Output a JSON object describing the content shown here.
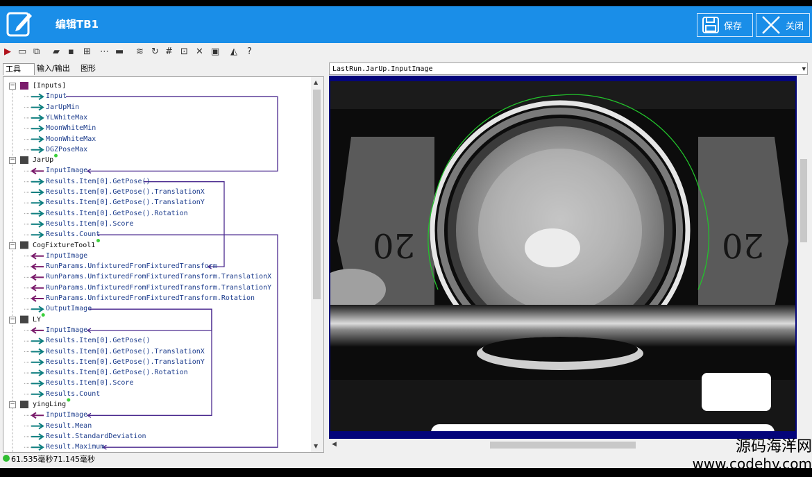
{
  "window": {
    "title": "编辑TB1",
    "save_label": "保存",
    "close_label": "关闭"
  },
  "tabs": [
    {
      "label": "工具",
      "active": true
    },
    {
      "label": "输入/输出",
      "active": false
    },
    {
      "label": "图形",
      "active": false
    }
  ],
  "toolbar_icons": [
    "run-icon",
    "image-icon",
    "link-icon",
    "open-folder-icon",
    "save-disk-icon",
    "network-icon",
    "dashes-icon",
    "tag-icon",
    "database-icon",
    "refresh-icon",
    "numeric-icon",
    "zoom-icon",
    "wrench-icon",
    "code-icon",
    "chart-icon",
    "help-icon"
  ],
  "tree": [
    {
      "kind": "group",
      "label": "[Inputs]",
      "icon": "input-arrow-icon"
    },
    {
      "kind": "out",
      "label": "Input"
    },
    {
      "kind": "out",
      "label": "JarUpMin"
    },
    {
      "kind": "out",
      "label": "YLWhiteMax"
    },
    {
      "kind": "out",
      "label": "MoonWhiteMin"
    },
    {
      "kind": "out",
      "label": "MoonWhiteMax"
    },
    {
      "kind": "out",
      "label": "DGZPoseMax"
    },
    {
      "kind": "tool",
      "label": "JarUp",
      "icon": "pattern-tool-icon"
    },
    {
      "kind": "in",
      "label": "InputImage"
    },
    {
      "kind": "out",
      "label": "Results.Item[0].GetPose()"
    },
    {
      "kind": "out",
      "label": "Results.Item[0].GetPose().TranslationX"
    },
    {
      "kind": "out",
      "label": "Results.Item[0].GetPose().TranslationY"
    },
    {
      "kind": "out",
      "label": "Results.Item[0].GetPose().Rotation"
    },
    {
      "kind": "out",
      "label": "Results.Item[0].Score"
    },
    {
      "kind": "out",
      "label": "Results.Count"
    },
    {
      "kind": "tool",
      "label": "CogFixtureTool1",
      "icon": "fixture-tool-icon"
    },
    {
      "kind": "in",
      "label": "InputImage"
    },
    {
      "kind": "in",
      "label": "RunParams.UnfixturedFromFixturedTransform"
    },
    {
      "kind": "in",
      "label": "RunParams.UnfixturedFromFixturedTransform.TranslationX"
    },
    {
      "kind": "in",
      "label": "RunParams.UnfixturedFromFixturedTransform.TranslationY"
    },
    {
      "kind": "in",
      "label": "RunParams.UnfixturedFromFixturedTransform.Rotation"
    },
    {
      "kind": "out",
      "label": "OutputImage"
    },
    {
      "kind": "tool",
      "label": "LY",
      "icon": "pattern-tool-icon"
    },
    {
      "kind": "in",
      "label": "InputImage"
    },
    {
      "kind": "out",
      "label": "Results.Item[0].GetPose()"
    },
    {
      "kind": "out",
      "label": "Results.Item[0].GetPose().TranslationX"
    },
    {
      "kind": "out",
      "label": "Results.Item[0].GetPose().TranslationY"
    },
    {
      "kind": "out",
      "label": "Results.Item[0].GetPose().Rotation"
    },
    {
      "kind": "out",
      "label": "Results.Item[0].Score"
    },
    {
      "kind": "out",
      "label": "Results.Count"
    },
    {
      "kind": "tool",
      "label": "yingLing",
      "icon": "histogram-tool-icon"
    },
    {
      "kind": "in",
      "label": "InputImage"
    },
    {
      "kind": "out",
      "label": "Result.Mean"
    },
    {
      "kind": "out",
      "label": "Result.StandardDeviation"
    },
    {
      "kind": "out",
      "label": "Result.Maximum"
    }
  ],
  "status_text": "61.535毫秒71.145毫秒",
  "image_source": "LastRun.JarUp.InputImage",
  "watermark": {
    "line1": "源码海洋网",
    "line2": "www.codehy.com"
  },
  "colors": {
    "titlebar": "#1a8ee8",
    "output_arrow": "#0f7f80",
    "input_arrow": "#7a1b6b",
    "link_line": "#4b2a8f",
    "image_frame": "#04057a",
    "graphic_green": "#22c22b"
  }
}
